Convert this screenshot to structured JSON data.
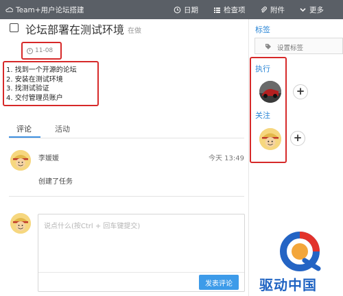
{
  "topbar": {
    "project": "Team+用户论坛搭建",
    "menu": [
      {
        "label": "日期",
        "icon": "clock-icon"
      },
      {
        "label": "检查项",
        "icon": "list-icon"
      },
      {
        "label": "附件",
        "icon": "paperclip-icon"
      },
      {
        "label": "更多",
        "icon": "chevron-down-icon"
      }
    ]
  },
  "task": {
    "title": "论坛部署在测试环境",
    "status": "在做",
    "due_date": "11-08",
    "checklist": [
      "1.  找到一个开源的论坛",
      "2.  安装在测试环境",
      "3.  找测试验证",
      "4.  交付管理员账户"
    ]
  },
  "tabs": [
    {
      "label": "评论",
      "active": true
    },
    {
      "label": "活动",
      "active": false
    }
  ],
  "comments": [
    {
      "author": "李媛媛",
      "time": "今天 13:49",
      "text": "创建了任务"
    }
  ],
  "reply": {
    "placeholder": "说点什么(按Ctrl + 回车键提交)",
    "submit_label": "发表评论"
  },
  "sidebar": {
    "tags_heading": "标签",
    "tags_placeholder": "设置标签",
    "executor_heading": "执行",
    "followers_heading": "关注",
    "add_symbol": "+"
  },
  "watermark": {
    "text": "驱动中国"
  },
  "colors": {
    "topbar_bg": "#5a5f66",
    "accent": "#3d9be9",
    "heading_blue": "#2b86d6",
    "highlight_red": "#d62828"
  }
}
